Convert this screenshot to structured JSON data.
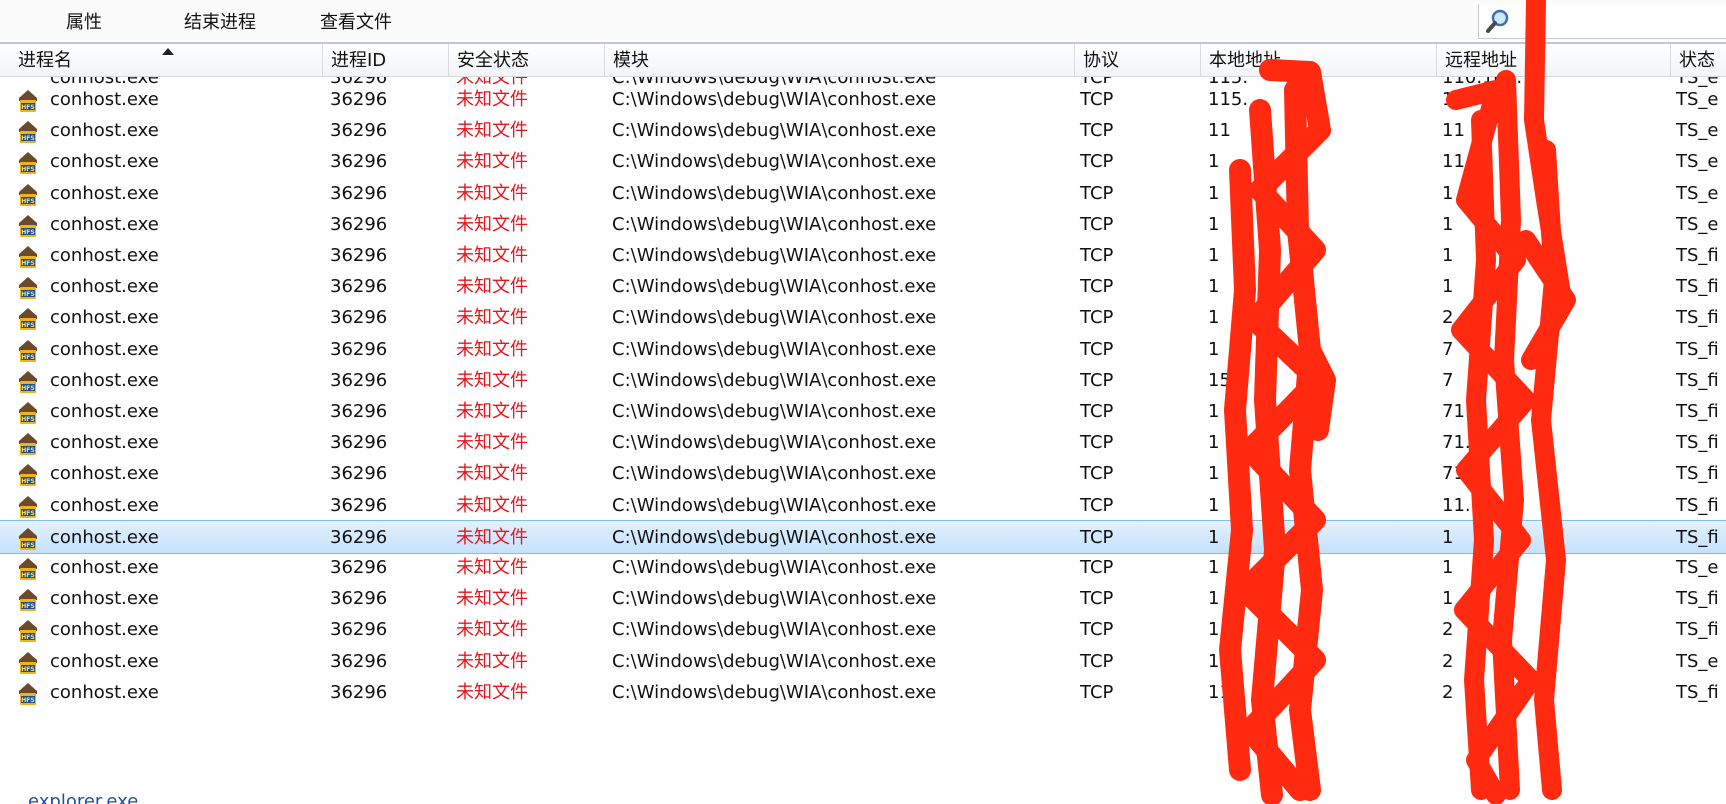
{
  "toolbar": {
    "properties": "属性",
    "end_process": "结束进程",
    "view_file": "查看文件"
  },
  "columns": {
    "name": "进程名",
    "pid": "进程ID",
    "security": "安全状态",
    "module": "模块",
    "protocol": "协议",
    "local": "本地地址",
    "remote": "远程地址",
    "state": "状态"
  },
  "partial_top": {
    "name": "conhost.exe",
    "pid": "36296",
    "security": "未知文件",
    "module": "C:\\Windows\\debug\\WIA\\conhost.exe",
    "protocol": "TCP",
    "local": "115.",
    "remote": "110.103.",
    "state": "TS_e"
  },
  "rows": [
    {
      "name": "conhost.exe",
      "pid": "36296",
      "security": "未知文件",
      "module": "C:\\Windows\\debug\\WIA\\conhost.exe",
      "protocol": "TCP",
      "local": "115.",
      "remote": "11",
      "state": "TS_e",
      "selected": false
    },
    {
      "name": "conhost.exe",
      "pid": "36296",
      "security": "未知文件",
      "module": "C:\\Windows\\debug\\WIA\\conhost.exe",
      "protocol": "TCP",
      "local": "11",
      "remote": "11",
      "state": "TS_e",
      "selected": false
    },
    {
      "name": "conhost.exe",
      "pid": "36296",
      "security": "未知文件",
      "module": "C:\\Windows\\debug\\WIA\\conhost.exe",
      "protocol": "TCP",
      "local": "1",
      "remote": "11",
      "state": "TS_e",
      "selected": false
    },
    {
      "name": "conhost.exe",
      "pid": "36296",
      "security": "未知文件",
      "module": "C:\\Windows\\debug\\WIA\\conhost.exe",
      "protocol": "TCP",
      "local": "1",
      "remote": "1",
      "state": "TS_e",
      "selected": false
    },
    {
      "name": "conhost.exe",
      "pid": "36296",
      "security": "未知文件",
      "module": "C:\\Windows\\debug\\WIA\\conhost.exe",
      "protocol": "TCP",
      "local": "1",
      "remote": "1",
      "state": "TS_e",
      "selected": false
    },
    {
      "name": "conhost.exe",
      "pid": "36296",
      "security": "未知文件",
      "module": "C:\\Windows\\debug\\WIA\\conhost.exe",
      "protocol": "TCP",
      "local": "1",
      "remote": "1",
      "state": "TS_fi",
      "selected": false
    },
    {
      "name": "conhost.exe",
      "pid": "36296",
      "security": "未知文件",
      "module": "C:\\Windows\\debug\\WIA\\conhost.exe",
      "protocol": "TCP",
      "local": "1",
      "remote": "1",
      "state": "TS_fi",
      "selected": false
    },
    {
      "name": "conhost.exe",
      "pid": "36296",
      "security": "未知文件",
      "module": "C:\\Windows\\debug\\WIA\\conhost.exe",
      "protocol": "TCP",
      "local": "1",
      "remote": "2",
      "state": "TS_fi",
      "selected": false
    },
    {
      "name": "conhost.exe",
      "pid": "36296",
      "security": "未知文件",
      "module": "C:\\Windows\\debug\\WIA\\conhost.exe",
      "protocol": "TCP",
      "local": "1",
      "remote": "7",
      "state": "TS_fi",
      "selected": false
    },
    {
      "name": "conhost.exe",
      "pid": "36296",
      "security": "未知文件",
      "module": "C:\\Windows\\debug\\WIA\\conhost.exe",
      "protocol": "TCP",
      "local": "15",
      "remote": "7",
      "state": "TS_fi",
      "selected": false
    },
    {
      "name": "conhost.exe",
      "pid": "36296",
      "security": "未知文件",
      "module": "C:\\Windows\\debug\\WIA\\conhost.exe",
      "protocol": "TCP",
      "local": "1",
      "remote": "71.2",
      "state": "TS_fi",
      "selected": false
    },
    {
      "name": "conhost.exe",
      "pid": "36296",
      "security": "未知文件",
      "module": "C:\\Windows\\debug\\WIA\\conhost.exe",
      "protocol": "TCP",
      "local": "1",
      "remote": "71.2",
      "state": "TS_fi",
      "selected": false
    },
    {
      "name": "conhost.exe",
      "pid": "36296",
      "security": "未知文件",
      "module": "C:\\Windows\\debug\\WIA\\conhost.exe",
      "protocol": "TCP",
      "local": "1",
      "remote": "71.",
      "state": "TS_fi",
      "selected": false
    },
    {
      "name": "conhost.exe",
      "pid": "36296",
      "security": "未知文件",
      "module": "C:\\Windows\\debug\\WIA\\conhost.exe",
      "protocol": "TCP",
      "local": "1",
      "remote": "11.",
      "state": "TS_fi",
      "selected": false
    },
    {
      "name": "conhost.exe",
      "pid": "36296",
      "security": "未知文件",
      "module": "C:\\Windows\\debug\\WIA\\conhost.exe",
      "protocol": "TCP",
      "local": "1",
      "remote": "1",
      "state": "TS_fi",
      "selected": true
    },
    {
      "name": "conhost.exe",
      "pid": "36296",
      "security": "未知文件",
      "module": "C:\\Windows\\debug\\WIA\\conhost.exe",
      "protocol": "TCP",
      "local": "1",
      "remote": "1",
      "state": "TS_e",
      "selected": false
    },
    {
      "name": "conhost.exe",
      "pid": "36296",
      "security": "未知文件",
      "module": "C:\\Windows\\debug\\WIA\\conhost.exe",
      "protocol": "TCP",
      "local": "1",
      "remote": "1",
      "state": "TS_fi",
      "selected": false
    },
    {
      "name": "conhost.exe",
      "pid": "36296",
      "security": "未知文件",
      "module": "C:\\Windows\\debug\\WIA\\conhost.exe",
      "protocol": "TCP",
      "local": "1",
      "remote": "2",
      "state": "TS_fi",
      "selected": false
    },
    {
      "name": "conhost.exe",
      "pid": "36296",
      "security": "未知文件",
      "module": "C:\\Windows\\debug\\WIA\\conhost.exe",
      "protocol": "TCP",
      "local": "1",
      "remote": "2",
      "state": "TS_e",
      "selected": false
    },
    {
      "name": "conhost.exe",
      "pid": "36296",
      "security": "未知文件",
      "module": "C:\\Windows\\debug\\WIA\\conhost.exe",
      "protocol": "TCP",
      "local": "11",
      "remote": "2",
      "state": "TS_fi",
      "selected": false
    }
  ],
  "partial_bottom": "explorer.exe",
  "colors": {
    "unknown_file": "#e8141d",
    "selected_row": "#c5e1fb",
    "redaction": "#ff2a10"
  },
  "icons": {
    "process": "hfs-process-icon",
    "search": "magnifier-icon"
  }
}
